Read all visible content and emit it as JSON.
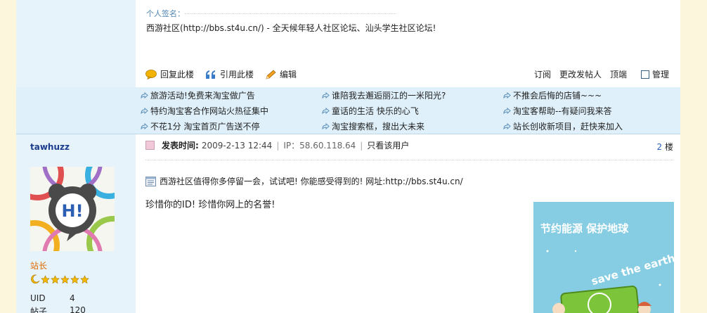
{
  "post1": {
    "signature_label": "个人签名：",
    "signature_text": "西游社区(http://bbs.st4u.cn/) - 全天候年轻人社区论坛、汕头学生社区论坛!",
    "actions": {
      "reply": "回复此楼",
      "quote": "引用此楼",
      "edit": "编辑",
      "subscribe": "订阅",
      "change_author": "更改发帖人",
      "top": "顶端",
      "manage": "管理"
    }
  },
  "ads": {
    "col1": [
      "旅游活动!免费来淘宝做广告",
      "特约淘宝客合作网站火热征集中",
      "不花1分  淘宝首页广告送不停"
    ],
    "col2": [
      "谁陪我去邂逅丽江的一米阳光?",
      "童话的生活  快乐的心飞",
      "淘宝搜索框，搜出大未来"
    ],
    "col3": [
      "不推会后悔的店铺~~~",
      "淘宝客帮助--有疑问我来答",
      "站长创收新项目，赶快来加入"
    ]
  },
  "post2": {
    "author": "tawhuzz",
    "rank": "站长",
    "stats": [
      {
        "label": "UID",
        "value": "4"
      },
      {
        "label": "帖子",
        "value": "120"
      }
    ],
    "posted_label": "发表时间:",
    "posted_time": "2009-2-13 12:44",
    "ip": "IP：58.60.118.64",
    "only_view": "只看该用户",
    "floor_number": "2",
    "floor_suffix": "楼",
    "notice": "西游社区值得你多停留一会，试试吧! 你能感受得到的!   网址:http://bbs.st4u.cn/",
    "content": "珍惜你的ID! 珍惜你网上的名誉!",
    "banner_title": "节约能源 保护地球",
    "banner_sub": "save the earth"
  },
  "colors": {
    "page_bg": "#fcf6dc",
    "side_bg": "#e6f3fb",
    "ad_bg": "#dff0fa",
    "link_blue": "#2b62b8",
    "author_blue": "#1c3d8c",
    "rank_orange": "#e06a00"
  }
}
